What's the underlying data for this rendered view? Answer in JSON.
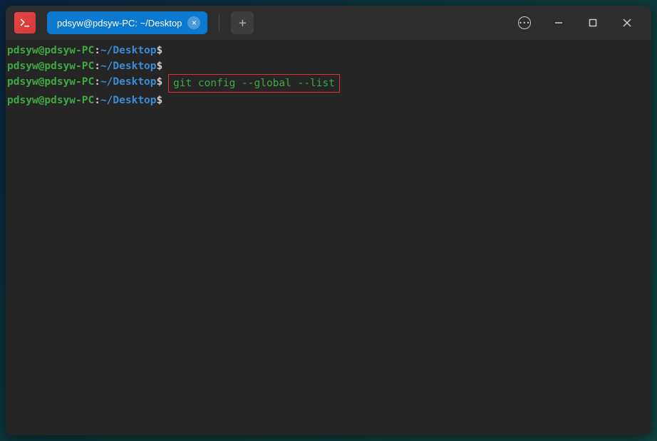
{
  "titlebar": {
    "tab_title": "pdsyw@pdsyw-PC: ~/Desktop"
  },
  "prompt": {
    "user_host": "pdsyw@pdsyw-PC",
    "separator": ":",
    "path": "~/Desktop",
    "symbol": "$"
  },
  "lines": {
    "l1_command": "",
    "l2_command": "",
    "l3_command": "git config --global --list",
    "l4_command": ""
  }
}
